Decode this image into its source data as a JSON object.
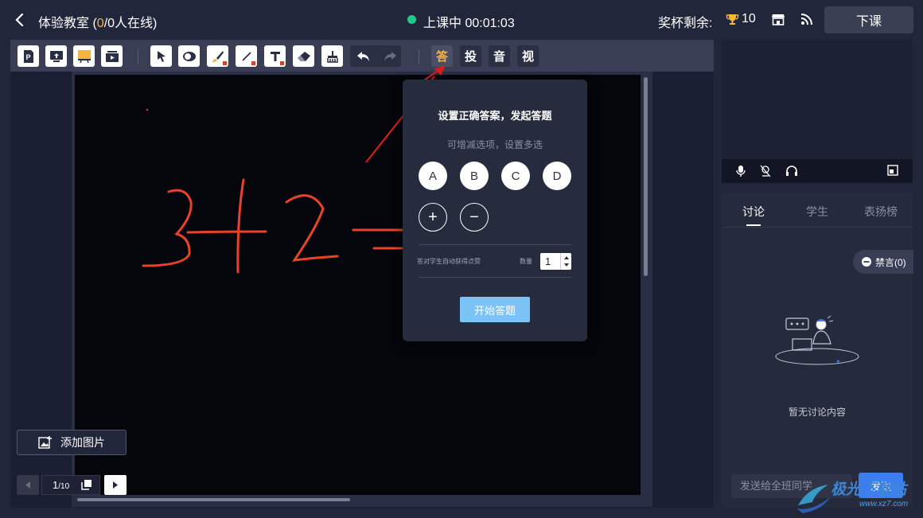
{
  "topbar": {
    "title_prefix": "体验教室",
    "title_open": " (",
    "online_count": "0",
    "title_suffix": "/0人在线)",
    "status": "上课中 00:01:03",
    "cup_label": "奖杯剩余:",
    "cup_count": "10",
    "end_class_label": "下课"
  },
  "toolbar": {
    "answer_label": "答",
    "vote_label": "投",
    "audio_label": "音",
    "video_label": "视"
  },
  "answer_popup": {
    "title": "设置正确答案，发起答题",
    "subtitle": "可增减选项，设置多选",
    "options": [
      "A",
      "B",
      "C",
      "D"
    ],
    "plus_label": "+",
    "minus_label": "−",
    "reward_label": "答对学生自动获得点赞",
    "quantity_label": "数量",
    "quantity_value": "1",
    "start_label": "开始答题"
  },
  "board": {
    "add_image_label": "添加图片",
    "page_current": "1",
    "page_total": "/10"
  },
  "side": {
    "tabs": [
      "讨论",
      "学生",
      "表扬榜"
    ],
    "mute_label": "禁言(0)",
    "empty_text": "暂无讨论内容",
    "chat_placeholder": "发送给全班同学",
    "send_label": "发送"
  },
  "watermark": {
    "text": "极光下载站",
    "url": "www.xz7.com"
  },
  "colors": {
    "accent": "#f6b53b",
    "ink": "#e8432a",
    "live": "#22c88a",
    "primary": "#3c7ef0"
  }
}
